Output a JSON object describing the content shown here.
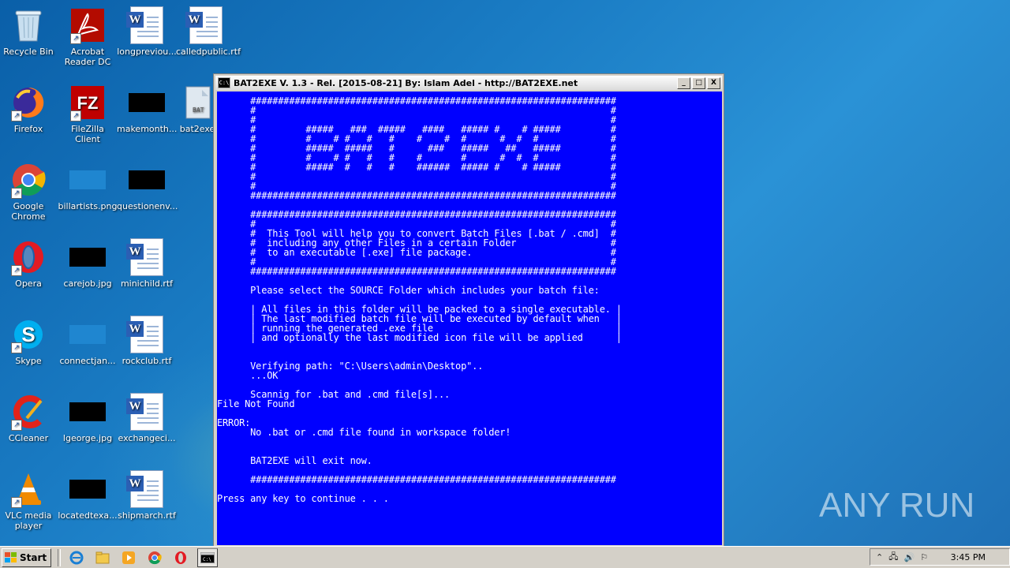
{
  "desktop": {
    "icons": [
      {
        "label": "Recycle Bin"
      },
      {
        "label": "Acrobat Reader DC"
      },
      {
        "label": "longpreviou..."
      },
      {
        "label": "calledpublic.rtf"
      },
      {
        "label": "Firefox"
      },
      {
        "label": "FileZilla Client"
      },
      {
        "label": "makemonth..."
      },
      {
        "label": "bat2exe"
      },
      {
        "label": "Google Chrome"
      },
      {
        "label": "billartists.png"
      },
      {
        "label": "questionenv..."
      },
      {
        "label": "Opera"
      },
      {
        "label": "carejob.jpg"
      },
      {
        "label": "minichild.rtf"
      },
      {
        "label": "Skype"
      },
      {
        "label": "connectjan..."
      },
      {
        "label": "rockclub.rtf"
      },
      {
        "label": "CCleaner"
      },
      {
        "label": "lgeorge.jpg"
      },
      {
        "label": "exchangeci..."
      },
      {
        "label": "VLC media player"
      },
      {
        "label": "locatedtexa..."
      },
      {
        "label": "shipmarch.rtf"
      }
    ]
  },
  "window": {
    "title": "BAT2EXE V. 1.3 - Rel. [2015-08-21] By: Islam Adel - http://BAT2EXE.net",
    "icon_text": "C:\\",
    "buttons": {
      "minimize": "_",
      "maximize": "□",
      "close": "X"
    },
    "console_text": "      ##################################################################\n      #                                                                #\n      #                                                                #\n      #         #####   ###  #####   ####   ##### #    # #####         #\n      #         #    # #   #   #    #    #  #      #  #  #             #\n      #         #####  #####   #      ###   #####   ##   #####         #\n      #         #    # #   #   #    #       #      #  #  #             #\n      #         #####  #   #   #    ######  ##### #    # #####         #\n      #                                                                #\n      #                                                                #\n      ##################################################################\n\n      ##################################################################\n      #                                                                #\n      #  This Tool will help you to convert Batch Files [.bat / .cmd]  #\n      #  including any other Files in a certain Folder                 #\n      #  to an executable [.exe] file package.                         #\n      #                                                                #\n      ##################################################################\n\n      Please select the SOURCE Folder which includes your batch file:\n\n      | All files in this folder will be packed to a single executable. |\n      | The last modified batch file will be executed by default when   |\n      | running the generated .exe file                                 |\n      | and optionally the last modified icon file will be applied      |\n\n\n      Verifying path: \"C:\\Users\\admin\\Desktop\"..\n      ...OK\n\n      Scannig for .bat and .cmd file[s]...\nFile Not Found\n\nERROR:\n      No .bat or .cmd file found in workspace folder!\n\n\n      BAT2EXE will exit now.\n\n      ##################################################################\n\nPress any key to continue . . ."
  },
  "taskbar": {
    "start_label": "Start",
    "clock": "3:45 PM"
  },
  "watermark": {
    "text": "ANY RUN"
  }
}
